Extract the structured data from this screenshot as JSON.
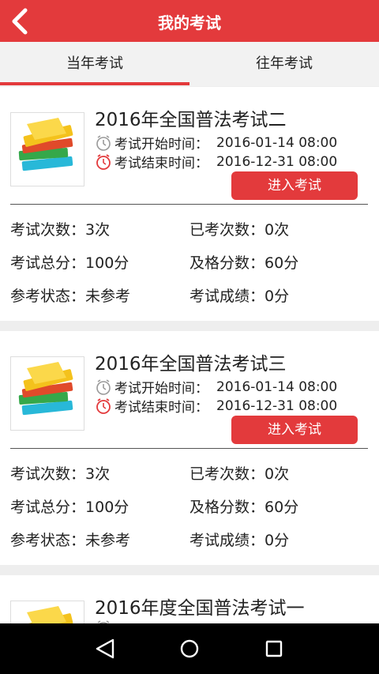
{
  "header": {
    "title": "我的考试"
  },
  "tabs": [
    {
      "label": "当年考试",
      "active": true
    },
    {
      "label": "往年考试",
      "active": false
    }
  ],
  "labels": {
    "start": "考试开始时间：",
    "end": "考试结束时间：",
    "enter": "进入考试",
    "count": "考试次数：",
    "taken": "已考次数：",
    "total": "考试总分：",
    "pass": "及格分数：",
    "status": "参考状态：",
    "result": "考试成绩："
  },
  "exams": [
    {
      "title": "2016年全国普法考试二",
      "start": "2016-01-14 08:00",
      "end": "2016-12-31 08:00",
      "count": "3次",
      "taken": "0次",
      "total": "100分",
      "pass": "60分",
      "status": "未参考",
      "result": "0分"
    },
    {
      "title": "2016年全国普法考试三",
      "start": "2016-01-14 08:00",
      "end": "2016-12-31 08:00",
      "count": "3次",
      "taken": "0次",
      "total": "100分",
      "pass": "60分",
      "status": "未参考",
      "result": "0分"
    },
    {
      "title": "2016年度全国普法考试一"
    }
  ],
  "colors": {
    "accent": "#e33a3c",
    "background": "#eeeeee"
  },
  "icons": {
    "back": "chevron-left-icon",
    "thumb": "books-icon",
    "start": "clock-icon",
    "end": "alarm-clock-icon",
    "nav": [
      "back-triangle-icon",
      "home-circle-icon",
      "recents-square-icon"
    ]
  }
}
